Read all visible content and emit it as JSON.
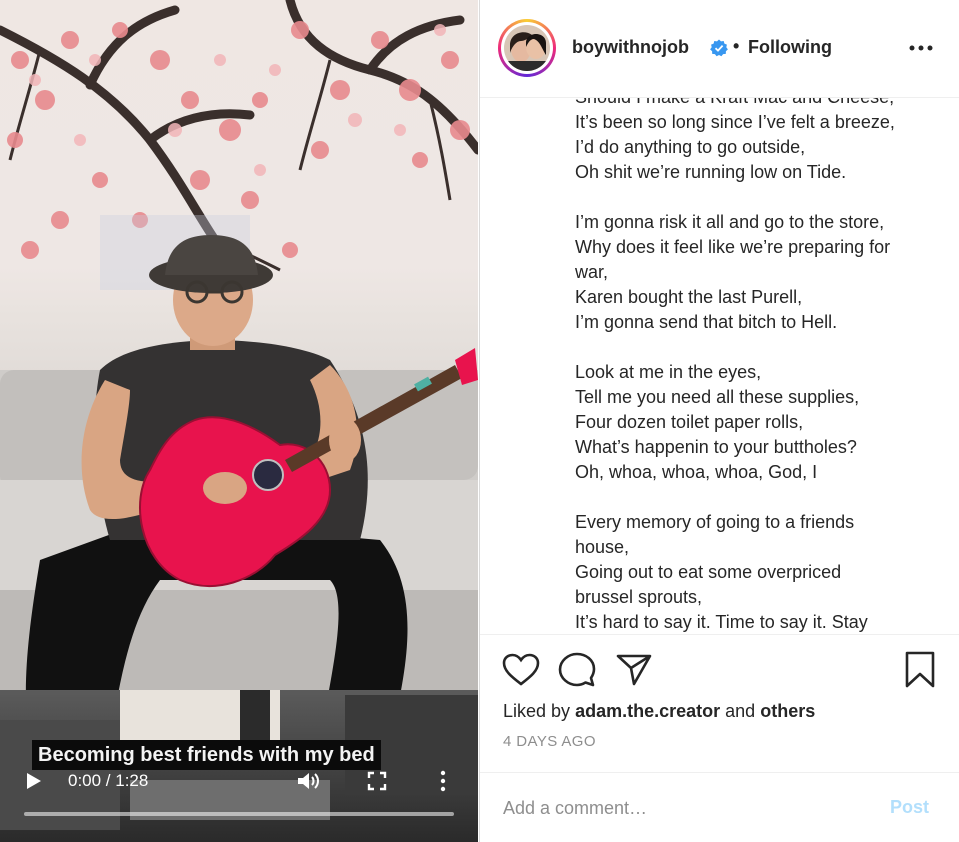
{
  "video": {
    "caption": "Becoming best friends with my bed",
    "time_display": "0:00 / 1:28",
    "progress_fraction": 0.0
  },
  "post_header": {
    "username": "boywithnojob",
    "verified": true,
    "separator": "•",
    "follow_status": "Following"
  },
  "lyrics": [
    [
      "Should I make a Kraft Mac and Cheese,",
      "It’s been so long since I’ve felt a breeze,",
      "I’d do anything to go outside,",
      "Oh shit we’re running low on Tide."
    ],
    [
      "I’m gonna risk it all and go to the store,",
      "Why does it feel like we’re preparing for",
      "war,",
      "Karen bought the last Purell,",
      "I’m gonna send that bitch to Hell."
    ],
    [
      "Look at me in the eyes,",
      "Tell me you need all these supplies,",
      "Four dozen toilet paper rolls,",
      "What’s happenin to your buttholes?",
      "Oh, whoa, whoa, whoa, God, I"
    ],
    [
      "Every memory of going to a friends",
      "house,",
      "Going out to eat some overpriced",
      "brussel sprouts,",
      "It’s hard to say it. Time to say it. Stay"
    ]
  ],
  "actions": {
    "liked_by_prefix": "Liked by",
    "liked_by_user": "adam.the.creator",
    "liked_by_and": "and",
    "liked_by_others": "others",
    "date": "4 DAYS AGO"
  },
  "comment": {
    "placeholder": "Add a comment…",
    "post_label": "Post"
  },
  "colors": {
    "verified_blue": "#3897f0",
    "post_button_disabled": "#b2dffc",
    "muted_text": "#8e8e8e"
  }
}
